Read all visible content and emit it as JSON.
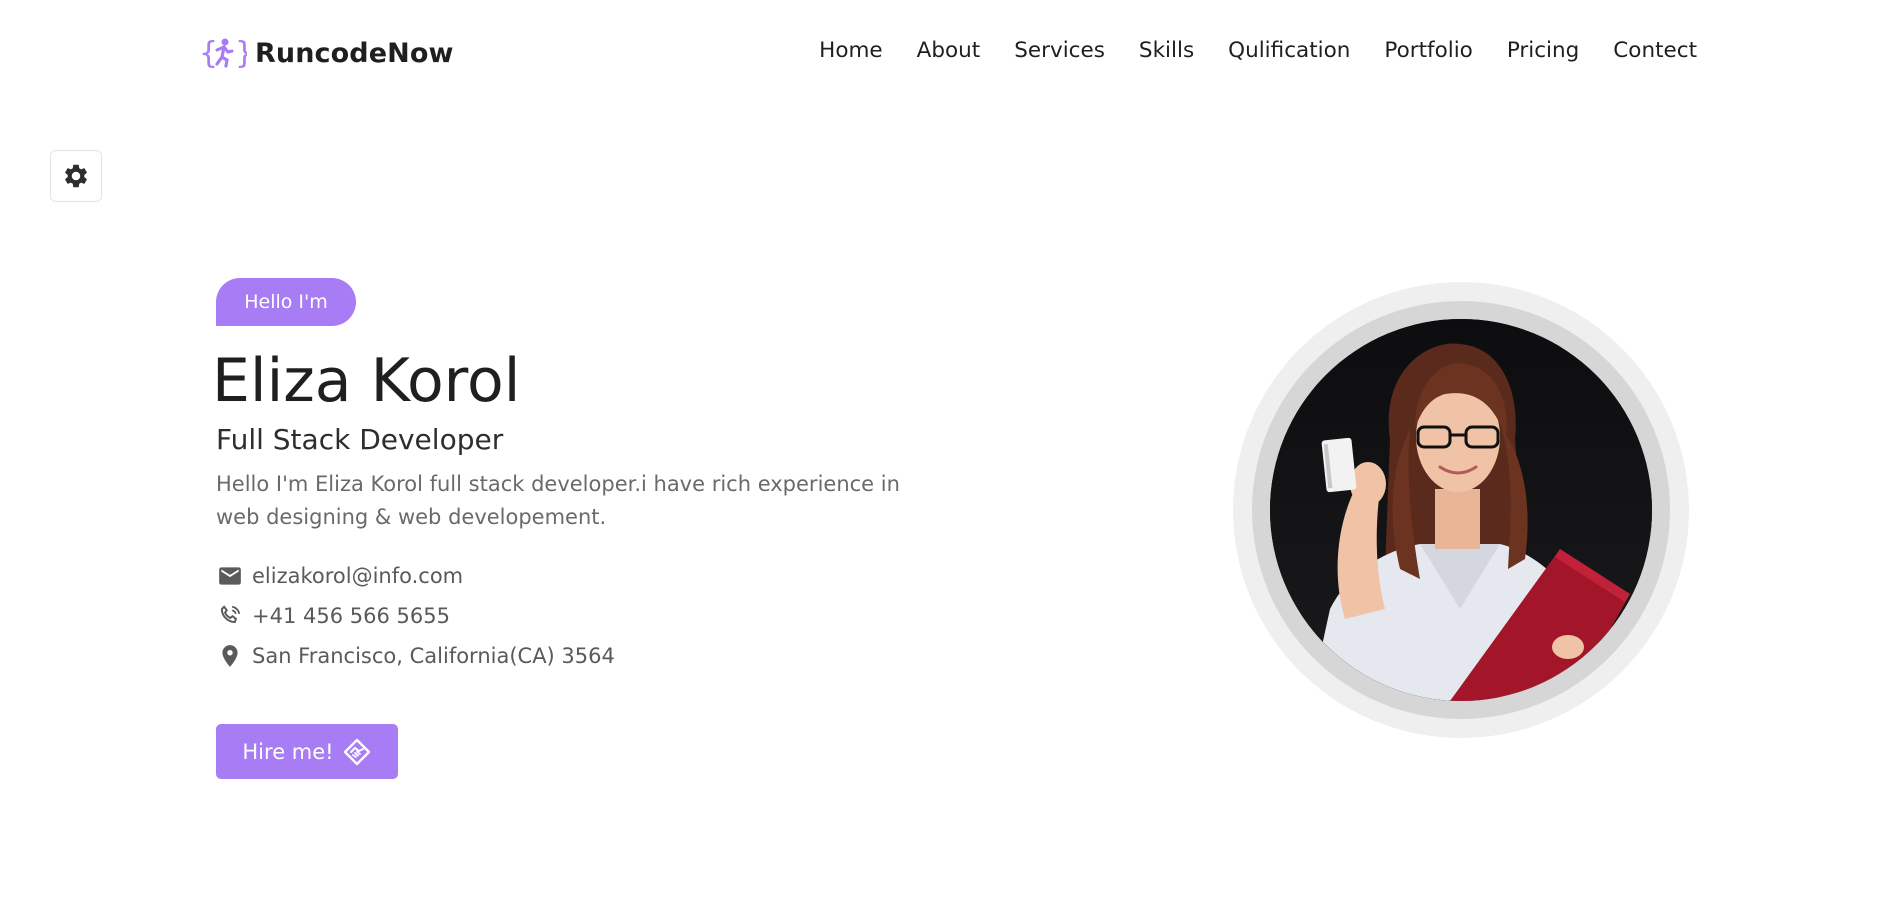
{
  "brand": {
    "name": "RuncodeNow",
    "icon": "curly-braces-runner-icon",
    "accent_color": "#a87cf5"
  },
  "nav": {
    "items": [
      {
        "label": "Home"
      },
      {
        "label": "About"
      },
      {
        "label": "Services"
      },
      {
        "label": "Skills"
      },
      {
        "label": "Qulification"
      },
      {
        "label": "Portfolio"
      },
      {
        "label": "Pricing"
      },
      {
        "label": "Contect"
      }
    ]
  },
  "settings": {
    "icon": "gear-icon"
  },
  "hero": {
    "badge": "Hello I'm",
    "name": "Eliza Korol",
    "role": "Full Stack Developer",
    "description": "Hello I'm Eliza Korol full stack developer.i have rich experience in web designing & web developement.",
    "contacts": [
      {
        "icon": "envelope-icon",
        "text": "elizakorol@info.com"
      },
      {
        "icon": "phone-icon",
        "text": "+41 456 566 5655"
      },
      {
        "icon": "map-pin-icon",
        "text": "San Francisco, California(CA) 3564"
      }
    ],
    "cta": {
      "label": "Hire me!",
      "icon": "handshake-icon"
    },
    "avatar": {
      "icon": "profile-photo"
    }
  }
}
